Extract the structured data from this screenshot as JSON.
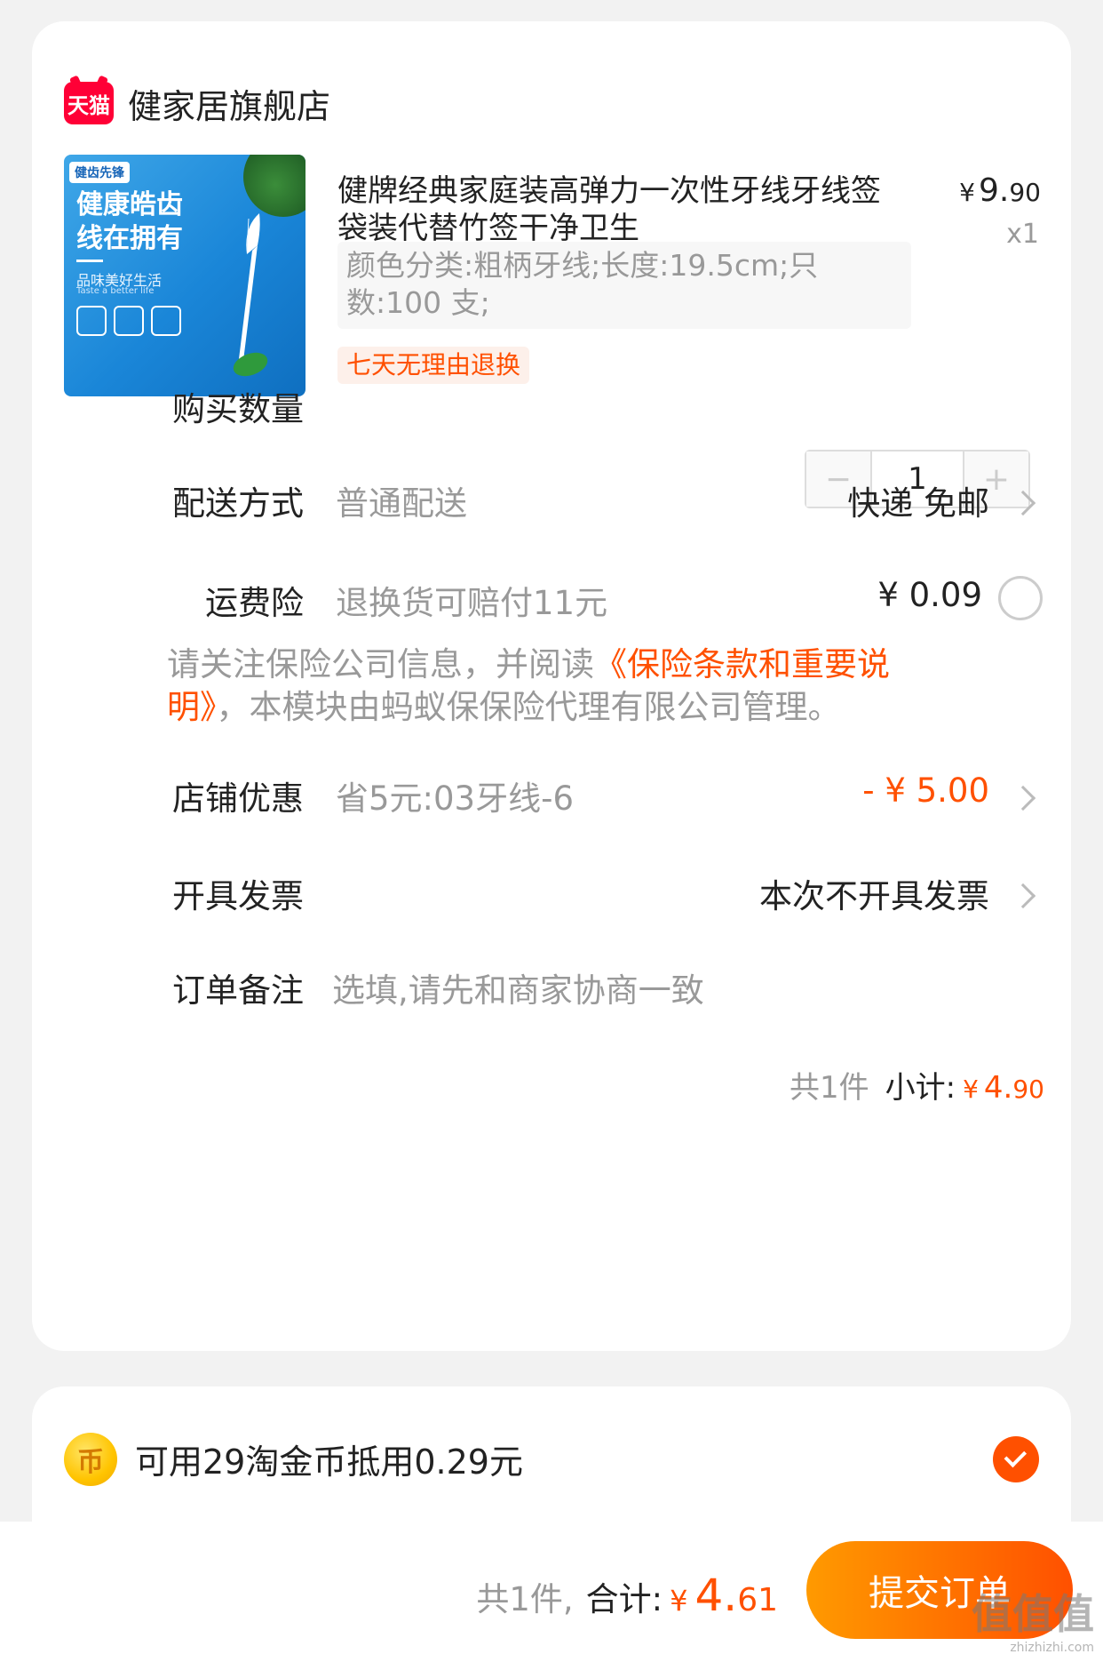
{
  "shop": {
    "badge": "天猫",
    "name": "健家居旗舰店"
  },
  "product": {
    "image": {
      "brand": "健齿先锋",
      "slogan_line1": "健康皓齿",
      "slogan_line2": "线在拥有",
      "subtitle": "品味美好生活",
      "subtitle_en": "Taste a better life"
    },
    "title": "健牌经典家庭装高弹力一次性牙线牙线签袋装代替竹签干净卫生",
    "price_symbol": "¥",
    "price_int": "9.",
    "price_dec": "90",
    "quantity_text": "x1",
    "spec": "颜色分类:粗柄牙线;长度:19.5cm;只数:100 支;",
    "return_tag": "七天无理由退换"
  },
  "rows": {
    "quantity": {
      "label": "购买数量",
      "minus": "−",
      "value": "1",
      "plus": "+"
    },
    "delivery": {
      "label": "配送方式",
      "sub": "普通配送",
      "value": "快递 免邮"
    },
    "insurance": {
      "label": "运费险",
      "sub": "退换货可赔付11元",
      "value": "¥ 0.09"
    },
    "notice": {
      "prefix": "请关注保险公司信息，并阅读",
      "link": "《保险条款和重要说明》",
      "suffix": "，本模块由蚂蚁保保险代理有限公司管理。"
    },
    "discount": {
      "label": "店铺优惠",
      "sub": "省5元:03牙线-6",
      "value": "- ¥ 5.00"
    },
    "invoice": {
      "label": "开具发票",
      "value": "本次不开具发票"
    },
    "remark": {
      "label": "订单备注",
      "placeholder": "选填,请先和商家协商一致"
    }
  },
  "subtotal": {
    "count_text": "共1件",
    "label": "小计:",
    "symbol": "¥",
    "int": "4.",
    "dec": "90"
  },
  "coin": {
    "icon_char": "币",
    "text": "可用29淘金币抵用0.29元"
  },
  "footer": {
    "count_text": "共1件,",
    "total_label": "合计:",
    "symbol": "¥",
    "int": "4.",
    "dec": "61",
    "submit_label": "提交订单"
  },
  "watermark": {
    "main": "值值值",
    "sub": "zhizhizhi.com"
  },
  "colors": {
    "accent": "#ff5000",
    "tmall_red": "#ff0036"
  }
}
